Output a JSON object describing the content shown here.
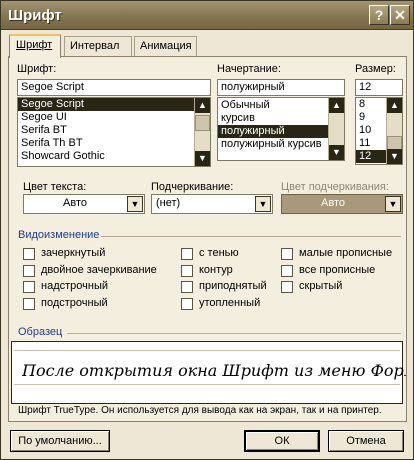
{
  "window": {
    "title": "Шрифт",
    "help_glyph": "?",
    "close_glyph": "✕"
  },
  "tabs": [
    {
      "label": "Шрифт",
      "active": true
    },
    {
      "label": "Интервал",
      "active": false
    },
    {
      "label": "Анимация",
      "active": false
    }
  ],
  "font": {
    "label": "Шрифт:",
    "value": "Segoe Script",
    "items": [
      "Segoe Script",
      "Segoe UI",
      "Serifa BT",
      "Serifa Th BT",
      "Showcard Gothic"
    ],
    "selected": "Segoe Script"
  },
  "style": {
    "label": "Начертание:",
    "value": "полужирный",
    "items": [
      "Обычный",
      "курсив",
      "полужирный",
      "полужирный курсив"
    ],
    "selected": "полужирный"
  },
  "size": {
    "label": "Размер:",
    "value": "12",
    "items": [
      "8",
      "9",
      "10",
      "11",
      "12"
    ],
    "selected": "12"
  },
  "text_color": {
    "label": "Цвет текста:",
    "value": "Авто"
  },
  "underline": {
    "label": "Подчеркивание:",
    "value": "(нет)"
  },
  "underline_color": {
    "label": "Цвет подчеркивания:",
    "value": "Авто",
    "enabled": false
  },
  "effects": {
    "title": "Видоизменение",
    "col1": [
      {
        "label": "зачеркнутый",
        "checked": false
      },
      {
        "label": "двойное зачеркивание",
        "checked": false
      },
      {
        "label": "надстрочный",
        "checked": false
      },
      {
        "label": "подстрочный",
        "checked": false
      }
    ],
    "col2": [
      {
        "label": "с тенью",
        "checked": false
      },
      {
        "label": "контур",
        "checked": false
      },
      {
        "label": "приподнятый",
        "checked": false
      },
      {
        "label": "утопленный",
        "checked": false
      }
    ],
    "col3": [
      {
        "label": "малые прописные",
        "checked": false
      },
      {
        "label": "все прописные",
        "checked": false
      },
      {
        "label": "скрытый",
        "checked": false
      }
    ]
  },
  "preview": {
    "title": "Образец",
    "text": "После открытия окна Шрифт из меню Формат"
  },
  "info_text": "Шрифт TrueType. Он используется для вывода как на экран, так и на принтер.",
  "buttons": {
    "default": "По умолчанию...",
    "ok": "ОК",
    "cancel": "Отмена"
  },
  "colors": {
    "title_bar": "#857550",
    "selection": "#2a2616",
    "dialog_bg": "#efe7d6",
    "disabled_combo": "#a9987a"
  }
}
